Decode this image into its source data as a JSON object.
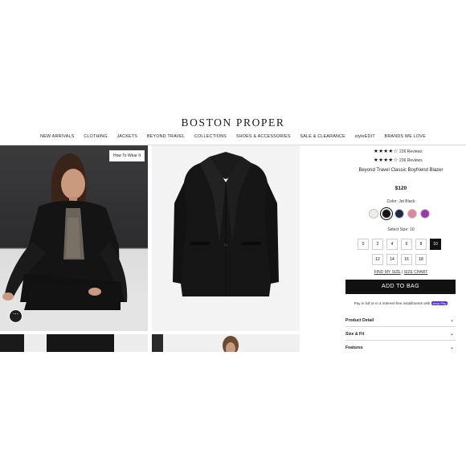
{
  "brand": "BOSTON PROPER",
  "nav": [
    "NEW ARRIVALS",
    "CLOTHING",
    "JACKETS",
    "BEYOND TRAVEL",
    "COLLECTIONS",
    "SHOES & ACCESSORIES",
    "SALE & CLEARANCE",
    "styleEDIT",
    "BRANDS WE LOVE"
  ],
  "gallery": {
    "how_to_wear": "How To Wear It",
    "chat_glyph": "⋯"
  },
  "product": {
    "rating_top": {
      "stars": "★★★★☆",
      "text": "236 Reviews"
    },
    "rating_sub": {
      "stars": "★★★★☆",
      "text": "236 Reviews"
    },
    "title": "Beyond Travel Classic Boyfriend Blazer",
    "price": "$120",
    "color_label": "Color: Jet Black",
    "swatch_colors": [
      "#f1ede4",
      "#141414",
      "#1d2a4d",
      "#d98a9a",
      "#9b3aa6"
    ],
    "size_label": "Select Size: 10",
    "sizes": [
      "0",
      "2",
      "4",
      "6",
      "8",
      "10",
      "12",
      "14",
      "16",
      "18"
    ],
    "selected_size": "10",
    "find_my_size": "FIND MY SIZE",
    "divider": "|",
    "size_chart": "SIZE CHART",
    "add_to_bag": "ADD TO BAG",
    "pay_text": "Pay in full or in 4 interest-free installments with",
    "shop_pay": "shop Pay",
    "accordions": [
      "Product Detail",
      "Size & Fit",
      "Features"
    ]
  }
}
